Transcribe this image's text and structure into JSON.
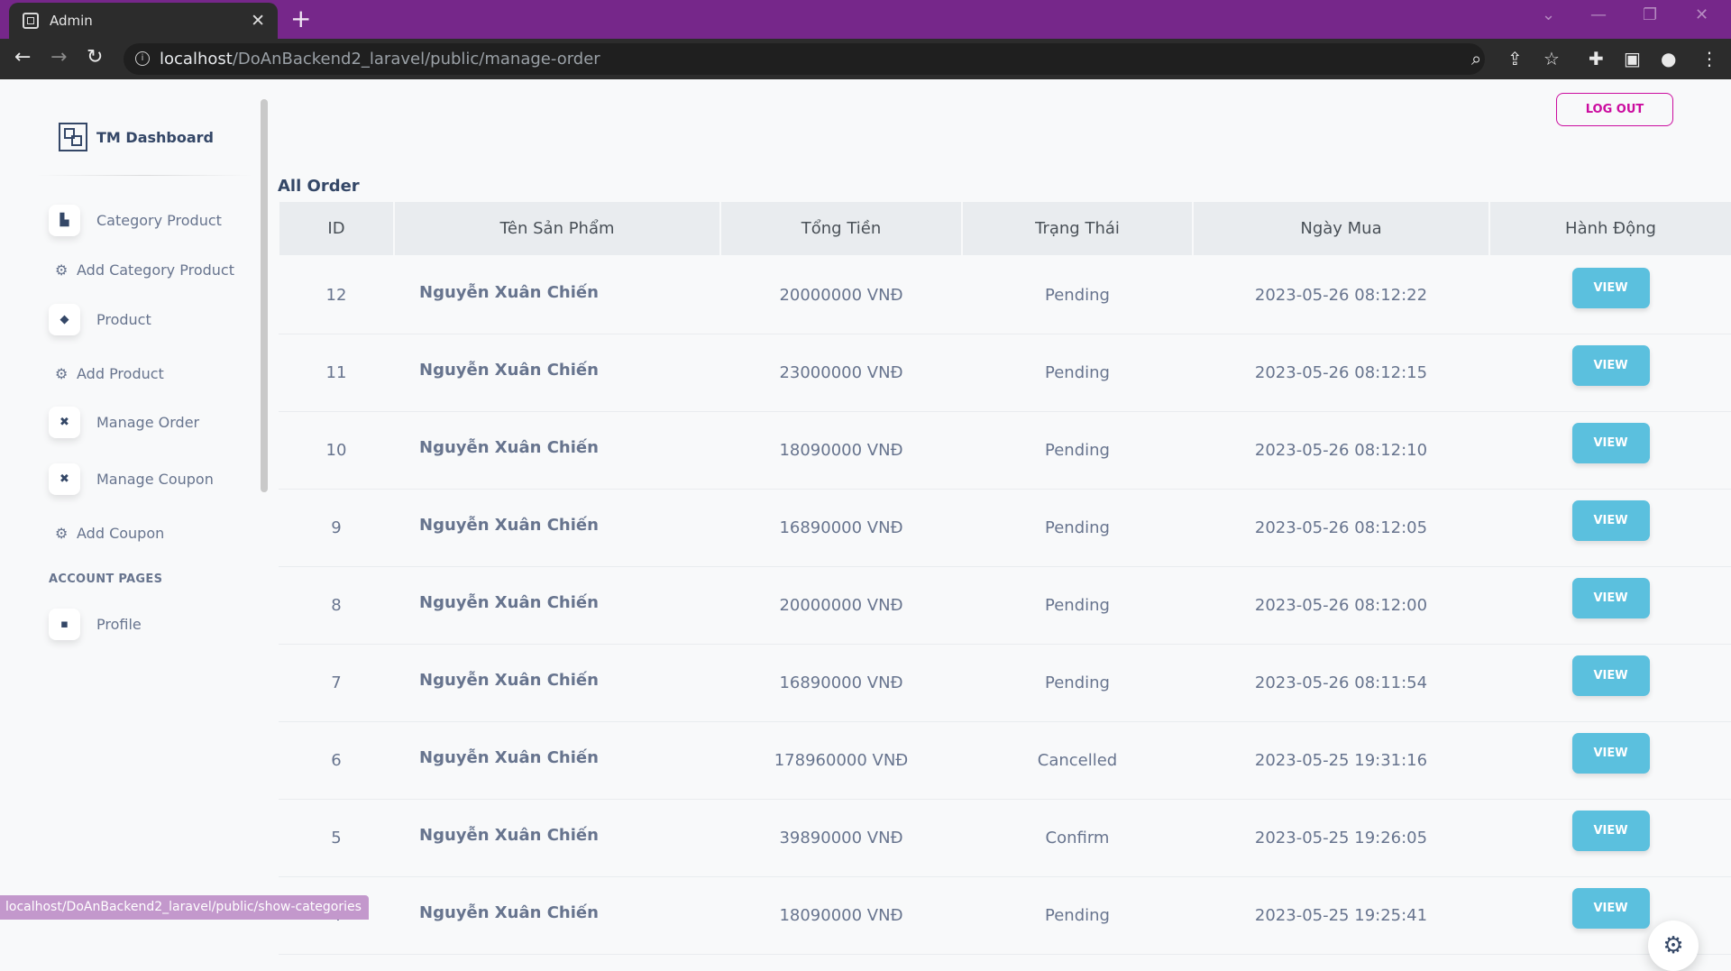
{
  "browser": {
    "tab_title": "Admin",
    "url_host": "localhost",
    "url_path": "/DoAnBackend2_laravel/public/manage-order",
    "status_url": "localhost/DoAnBackend2_laravel/public/show-categories"
  },
  "sidebar": {
    "brand": "TM Dashboard",
    "items": [
      {
        "label": "Category Product",
        "icon": "shop-icon"
      },
      {
        "label": "Add Category Product",
        "icon": "gear-icon"
      },
      {
        "label": "Product",
        "icon": "box-icon"
      },
      {
        "label": "Add Product",
        "icon": "gear-icon"
      },
      {
        "label": "Manage Order",
        "icon": "tools-icon"
      },
      {
        "label": "Manage Coupon",
        "icon": "tools-icon"
      },
      {
        "label": "Add Coupon",
        "icon": "gear-icon"
      }
    ],
    "section_title": "ACCOUNT PAGES",
    "profile": "Profile"
  },
  "header": {
    "logout": "LOG OUT"
  },
  "main": {
    "title": "All Order",
    "columns": [
      "ID",
      "Tên Sản Phẩm",
      "Tổng Tiền",
      "Trạng Thái",
      "Ngày Mua",
      "Hành Động"
    ],
    "rows": [
      {
        "id": "12",
        "name": "Nguyễn Xuân Chiến",
        "total": "20000000 VNĐ",
        "status": "Pending",
        "date": "2023-05-26 08:12:22",
        "action": "VIEW"
      },
      {
        "id": "11",
        "name": "Nguyễn Xuân Chiến",
        "total": "23000000 VNĐ",
        "status": "Pending",
        "date": "2023-05-26 08:12:15",
        "action": "VIEW"
      },
      {
        "id": "10",
        "name": "Nguyễn Xuân Chiến",
        "total": "18090000 VNĐ",
        "status": "Pending",
        "date": "2023-05-26 08:12:10",
        "action": "VIEW"
      },
      {
        "id": "9",
        "name": "Nguyễn Xuân Chiến",
        "total": "16890000 VNĐ",
        "status": "Pending",
        "date": "2023-05-26 08:12:05",
        "action": "VIEW"
      },
      {
        "id": "8",
        "name": "Nguyễn Xuân Chiến",
        "total": "20000000 VNĐ",
        "status": "Pending",
        "date": "2023-05-26 08:12:00",
        "action": "VIEW"
      },
      {
        "id": "7",
        "name": "Nguyễn Xuân Chiến",
        "total": "16890000 VNĐ",
        "status": "Pending",
        "date": "2023-05-26 08:11:54",
        "action": "VIEW"
      },
      {
        "id": "6",
        "name": "Nguyễn Xuân Chiến",
        "total": "178960000 VNĐ",
        "status": "Cancelled",
        "date": "2023-05-25 19:31:16",
        "action": "VIEW"
      },
      {
        "id": "5",
        "name": "Nguyễn Xuân Chiến",
        "total": "39890000 VNĐ",
        "status": "Confirm",
        "date": "2023-05-25 19:26:05",
        "action": "VIEW"
      },
      {
        "id": "4",
        "name": "Nguyễn Xuân Chiến",
        "total": "18090000 VNĐ",
        "status": "Pending",
        "date": "2023-05-25 19:25:41",
        "action": "VIEW"
      }
    ]
  },
  "colors": {
    "accent": "#cb0c9f",
    "view_button": "#5bc0de",
    "browser_frame": "#76278a"
  }
}
